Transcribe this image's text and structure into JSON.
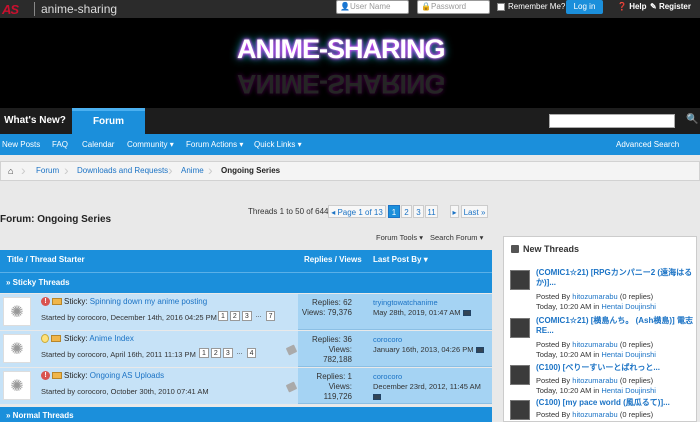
{
  "top": {
    "logo_mark": "AS",
    "logo_name": "anime-sharing",
    "username_placeholder": "User Name",
    "password_placeholder": "Password",
    "remember": "Remember Me?",
    "login": "Log in",
    "help": "Help",
    "register": "Register"
  },
  "banner": {
    "title": "ANIME-SHARING"
  },
  "nav": {
    "whats_new": "What's New?",
    "forum": "Forum"
  },
  "subnav": {
    "new_posts": "New Posts",
    "faq": "FAQ",
    "calendar": "Calendar",
    "community": "Community",
    "forum_actions": "Forum Actions",
    "quick_links": "Quick Links",
    "advanced_search": "Advanced Search"
  },
  "breadcrumb": {
    "forum": "Forum",
    "downloads": "Downloads and Requests",
    "anime": "Anime",
    "current": "Ongoing Series"
  },
  "page": {
    "title": "Forum: Ongoing Series",
    "thread_count": "Threads 1 to 50 of 644",
    "page_of": "Page 1 of 13",
    "pages": [
      "1",
      "2",
      "3",
      "11"
    ],
    "last": "Last",
    "forum_tools": "Forum Tools",
    "search_forum": "Search Forum"
  },
  "table": {
    "col_title": "Title / Thread Starter",
    "col_replies": "Replies / Views",
    "col_lastpost": "Last Post By",
    "sticky_hdr": "» Sticky Threads",
    "normal_hdr": "» Normal Threads",
    "rows": [
      {
        "prefix": "Sticky:",
        "title": "Spinning down my anime posting",
        "started": "Started by corocoro, December 14th, 2016 04:25 PM",
        "pages": [
          "1",
          "2",
          "3",
          "...",
          "7"
        ],
        "replies": "Replies: 62",
        "views": "Views: 79,376",
        "lp_user": "tryingtowatchanime",
        "lp_date": "May 28th, 2019, 01:47 AM"
      },
      {
        "prefix": "Sticky:",
        "title": "Anime Index",
        "started": "Started by corocoro, April 16th, 2011 11:13 PM",
        "pages": [
          "1",
          "2",
          "3",
          "...",
          "4"
        ],
        "replies": "Replies: 36",
        "views": "Views:",
        "views2": "782,188",
        "lp_user": "corocoro",
        "lp_date": "January 16th, 2013, 04:26 PM"
      },
      {
        "prefix": "Sticky:",
        "title": "Ongoing AS Uploads",
        "started": "Started by corocoro, October 30th, 2010 07:41 AM",
        "replies": "Replies: 1",
        "views": "Views:",
        "views2": "119,726",
        "lp_user": "corocoro",
        "lp_date": "December 23rd, 2012, 11:45 AM"
      }
    ]
  },
  "sidebar": {
    "title": "New Threads",
    "items": [
      {
        "title": "(COMIC1☆21) [RPGカンパニー2 (遠海はるか)]...",
        "by": "Posted By",
        "user": "hitozumarabu",
        "replies": "(0 replies)",
        "when": "Today, 10:20 AM in",
        "forum": "Hentai Doujinshi"
      },
      {
        "title": "(COMIC1☆21) [横島んち。 (Ash横島)] 電志 RE...",
        "by": "Posted By",
        "user": "hitozumarabu",
        "replies": "(0 replies)",
        "when": "Today, 10:20 AM in",
        "forum": "Hentai Doujinshi"
      },
      {
        "title": "(C100) [べりーすいーとぱれっと...",
        "by": "Posted By",
        "user": "hitozumarabu",
        "replies": "(0 replies)",
        "when": "Today, 10:20 AM in",
        "forum": "Hentai Doujinshi"
      },
      {
        "title": "(C100) [my pace world (風瓜るて)]...",
        "by": "Posted By",
        "user": "hitozumarabu",
        "replies": "(0 replies)",
        "when": "",
        "forum": ""
      }
    ]
  }
}
